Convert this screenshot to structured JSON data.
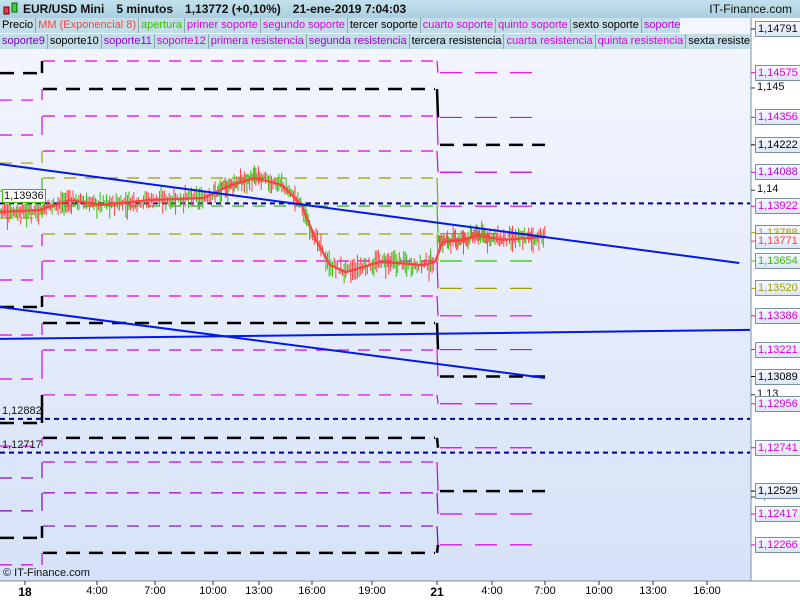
{
  "header": {
    "symbol": "EUR/USD Mini",
    "interval": "5 minutos",
    "price": "1,13772 (+0,10%)",
    "datetime": "21-ene-2019 7:04:03",
    "brand": "IT-Finance.com"
  },
  "legend_row1": [
    {
      "label": "Precio",
      "color": "#000000"
    },
    {
      "label": "MM (Exponencial 8)",
      "color": "#ff4040"
    },
    {
      "label": "apertura",
      "color": "#33c000"
    },
    {
      "label": "primer soporte",
      "color": "#e000e0"
    },
    {
      "label": "segundo soporte",
      "color": "#e000e0"
    },
    {
      "label": "tercer soporte",
      "color": "#000000"
    },
    {
      "label": "cuarto soporte",
      "color": "#e000e0"
    },
    {
      "label": "quinto soporte",
      "color": "#e000e0"
    },
    {
      "label": "sexto soporte",
      "color": "#000000"
    },
    {
      "label": "soporte 7",
      "color": "#c000e0"
    },
    {
      "label": "soporte 8",
      "color": "#b000e0"
    }
  ],
  "legend_row2": [
    {
      "label": "soporte9",
      "color": "#8000c0"
    },
    {
      "label": "soporte10",
      "color": "#000000"
    },
    {
      "label": "soporte11",
      "color": "#9000e0"
    },
    {
      "label": "soporte12",
      "color": "#d000d0"
    },
    {
      "label": "primera resistencia",
      "color": "#c000d0"
    },
    {
      "label": "segunda resistencia",
      "color": "#a000d0"
    },
    {
      "label": "tercera resistencia",
      "color": "#000000"
    },
    {
      "label": "cuarta resistencia",
      "color": "#e000e0"
    },
    {
      "label": "quinta resistencia",
      "color": "#e000e0"
    },
    {
      "label": "sexta resistencia",
      "color": "#000000"
    }
  ],
  "copyright": "© IT-Finance.com",
  "chart_data": {
    "type": "line",
    "title": "EUR/USD Mini 5 minutos",
    "ylim": [
      1.1212,
      1.1485
    ],
    "y_ticks": [
      "1,145",
      "1,14",
      "1,13",
      "1,125"
    ],
    "y_tick_values": [
      1.145,
      1.14,
      1.13,
      1.125
    ],
    "top_label": "1,14791",
    "x_ticks": [
      {
        "label": "18",
        "hour": 0,
        "bold": true
      },
      {
        "label": "4:00",
        "hour": 4
      },
      {
        "label": "7:00",
        "hour": 7
      },
      {
        "label": "10:00",
        "hour": 10
      },
      {
        "label": "13:00",
        "hour": 13
      },
      {
        "label": "16:00",
        "hour": 16
      },
      {
        "label": "19:00",
        "hour": 19
      },
      {
        "label": "21",
        "hour": 72,
        "bold": true
      },
      {
        "label": "4:00",
        "hour": 76
      },
      {
        "label": "7:00",
        "hour": 79
      },
      {
        "label": "10:00",
        "hour": 82
      },
      {
        "label": "13:00",
        "hour": 85
      },
      {
        "label": "16:00",
        "hour": 88
      }
    ],
    "ema_series": [
      [
        -1.4,
        1.13894
      ],
      [
        0.8,
        1.13903
      ],
      [
        2.5,
        1.13952
      ],
      [
        4.2,
        1.13928
      ],
      [
        6.7,
        1.13952
      ],
      [
        9.5,
        1.13962
      ],
      [
        11.2,
        1.14026
      ],
      [
        12.7,
        1.1406
      ],
      [
        14.3,
        1.14026
      ],
      [
        15.4,
        1.13928
      ],
      [
        16.2,
        1.13757
      ],
      [
        16.9,
        1.13634
      ],
      [
        17.7,
        1.136
      ],
      [
        18.4,
        1.1362
      ],
      [
        19.4,
        1.13649
      ],
      [
        20.5,
        1.13644
      ],
      [
        21.8,
        1.13634
      ],
      [
        22.5,
        1.13649
      ],
      [
        72.4,
        1.13747
      ],
      [
        73.8,
        1.13757
      ],
      [
        75,
        1.13781
      ],
      [
        76.6,
        1.13757
      ],
      [
        77.9,
        1.13766
      ],
      [
        79,
        1.13772
      ]
    ],
    "levels_prev": [
      {
        "p": 1.14573,
        "c": "#000000"
      },
      {
        "p": 1.14441,
        "c": "#e000e0"
      },
      {
        "p": 1.1427,
        "c": "#e000e0"
      },
      {
        "p": 1.14133,
        "c": "#a0a000"
      },
      {
        "p": 1.13996,
        "c": "#33c000"
      },
      {
        "p": 1.13864,
        "c": "#a0a000"
      },
      {
        "p": 1.13727,
        "c": "#e000e0"
      },
      {
        "p": 1.13561,
        "c": "#e000e0"
      },
      {
        "p": 1.13429,
        "c": "#000000"
      },
      {
        "p": 1.13292,
        "c": "#e000e0"
      },
      {
        "p": 1.13077,
        "c": "#e000e0"
      },
      {
        "p": 1.12862,
        "c": "#000000"
      },
      {
        "p": 1.12749,
        "c": "#e000e0"
      },
      {
        "p": 1.12593,
        "c": "#a000d0"
      },
      {
        "p": 1.12432,
        "c": "#8000c0"
      },
      {
        "p": 1.123,
        "c": "#000000"
      },
      {
        "p": 1.12168,
        "c": "#d000d0"
      }
    ],
    "levels_day18": [
      {
        "p": 1.14632,
        "c": "#e000e0"
      },
      {
        "p": 1.14495,
        "c": "#000000"
      },
      {
        "p": 1.14363,
        "c": "#e000e0"
      },
      {
        "p": 1.14192,
        "c": "#e000e0"
      },
      {
        "p": 1.1406,
        "c": "#a0a000"
      },
      {
        "p": 1.13923,
        "c": "#33c000"
      },
      {
        "p": 1.13786,
        "c": "#a0a000"
      },
      {
        "p": 1.13654,
        "c": "#e000e0"
      },
      {
        "p": 1.13483,
        "c": "#e000e0"
      },
      {
        "p": 1.13351,
        "c": "#000000"
      },
      {
        "p": 1.13219,
        "c": "#e000e0"
      },
      {
        "p": 1.12999,
        "c": "#e000e0"
      },
      {
        "p": 1.12789,
        "c": "#000000"
      },
      {
        "p": 1.12671,
        "c": "#e000e0"
      },
      {
        "p": 1.1252,
        "c": "#a000d0"
      },
      {
        "p": 1.12358,
        "c": "#8000c0"
      },
      {
        "p": 1.12227,
        "c": "#000000"
      }
    ],
    "levels_day21": [
      {
        "p": 1.14575,
        "label": "1,14575",
        "c": "#e000e0"
      },
      {
        "p": 1.14356,
        "label": "1,14356",
        "c": "#e000e0"
      },
      {
        "p": 1.14222,
        "label": "1,14222",
        "c": "#000000"
      },
      {
        "p": 1.14088,
        "label": "1,14088",
        "c": "#c000e0"
      },
      {
        "p": 1.13922,
        "label": "1,13922",
        "c": "#e000e0"
      },
      {
        "p": 1.13788,
        "label": "1,13788",
        "c": "#a0a000"
      },
      {
        "p": 1.13654,
        "label": "1,13654",
        "c": "#33c000"
      },
      {
        "p": 1.1352,
        "label": "1,13520",
        "c": "#a0a000"
      },
      {
        "p": 1.13386,
        "label": "1,13386",
        "c": "#e000e0"
      },
      {
        "p": 1.13221,
        "label": "1,13221",
        "c": "#e000e0"
      },
      {
        "p": 1.13089,
        "label": "1,13089",
        "c": "#000000"
      },
      {
        "p": 1.12956,
        "label": "1,12956",
        "c": "#e000e0"
      },
      {
        "p": 1.12741,
        "label": "1,12741",
        "c": "#e000e0"
      },
      {
        "p": 1.12529,
        "label": "1,12529",
        "c": "#000000"
      },
      {
        "p": 1.12417,
        "label": "1,12417",
        "c": "#e000e0"
      },
      {
        "p": 1.12266,
        "label": "1,12266",
        "c": "#e000e0"
      }
    ],
    "current_price": {
      "p": 1.13771,
      "label": "1,13771",
      "c": "#ff4040"
    },
    "horizontal_lines": [
      {
        "p": 1.13936,
        "label": "1,13936"
      },
      {
        "p": 1.12882,
        "label": "1,12882"
      },
      {
        "p": 1.12717,
        "label": "1,12717"
      }
    ],
    "trendlines": [
      [
        [
          -1.4,
          1.14128
        ],
        [
          89.8,
          1.13644
        ]
      ],
      [
        [
          -1.4,
          1.13429
        ],
        [
          79,
          1.13082
        ]
      ],
      [
        [
          -1.4,
          1.13273
        ],
        [
          90.4,
          1.13317
        ]
      ]
    ],
    "colors": {
      "trend": "#0018e8",
      "hline": "#000090",
      "ema": "#ff4040",
      "up": "#33c000",
      "down": "#ff4040"
    }
  }
}
